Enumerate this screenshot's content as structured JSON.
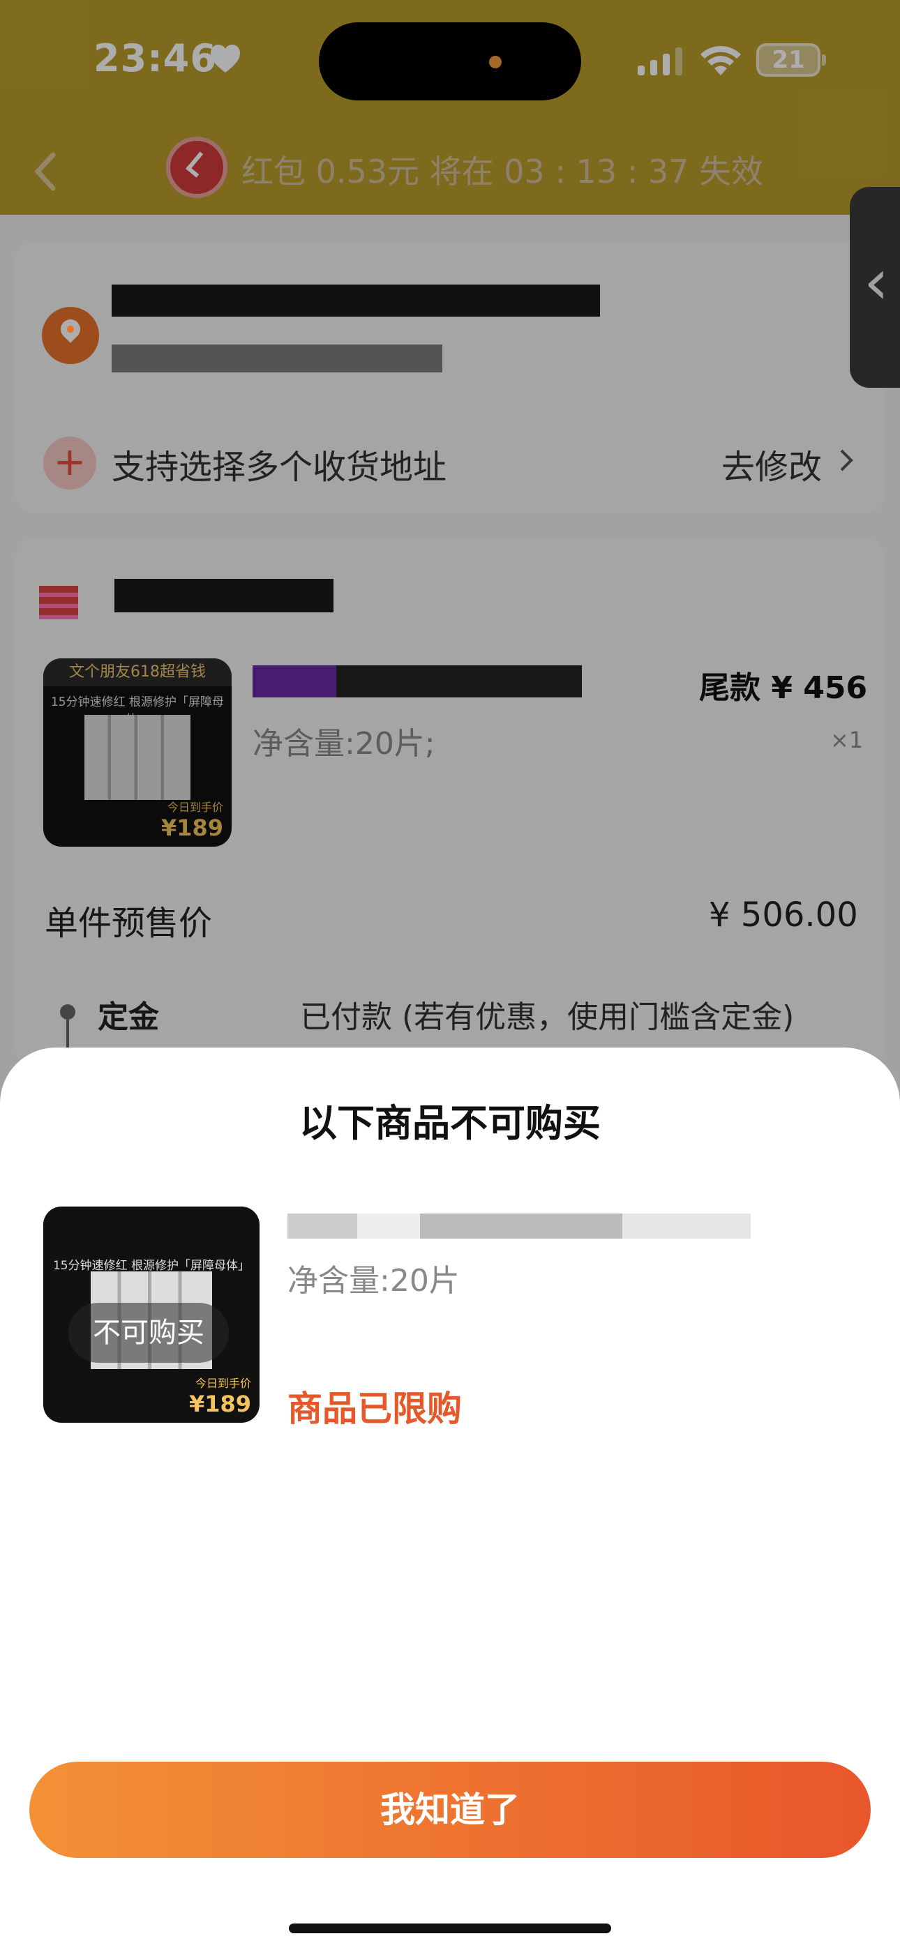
{
  "status_bar": {
    "time": "23:46",
    "battery": "21"
  },
  "header": {
    "red_packet_text": "红包 0.53元 将在 03 : 13 : 37 失效"
  },
  "address": {
    "multi_address_text": "支持选择多个收货地址",
    "modify_label": "去修改"
  },
  "order_item": {
    "final_payment": "尾款 ¥ 456",
    "spec": "净含量:20片;",
    "quantity": "×1",
    "image": {
      "banner": "文个朋友618超省钱",
      "sub": "15分钟速修红 根源修护「屏障母体」",
      "price_label": "今日到手价",
      "price": "¥189"
    }
  },
  "presale": {
    "label": "单件预售价",
    "value": "¥ 506.00"
  },
  "deposit": {
    "label": "定金",
    "value": "已付款 (若有优惠，使用门槛含定金)"
  },
  "sheet": {
    "title": "以下商品不可购买",
    "item": {
      "spec": "净含量:20片",
      "unavailable_badge": "不可购买",
      "status": "商品已限购",
      "image": {
        "sub": "15分钟速修红 根源修护「屏障母体」",
        "price_label": "今日到手价",
        "price": "¥189"
      }
    },
    "confirm_button": "我知道了"
  }
}
